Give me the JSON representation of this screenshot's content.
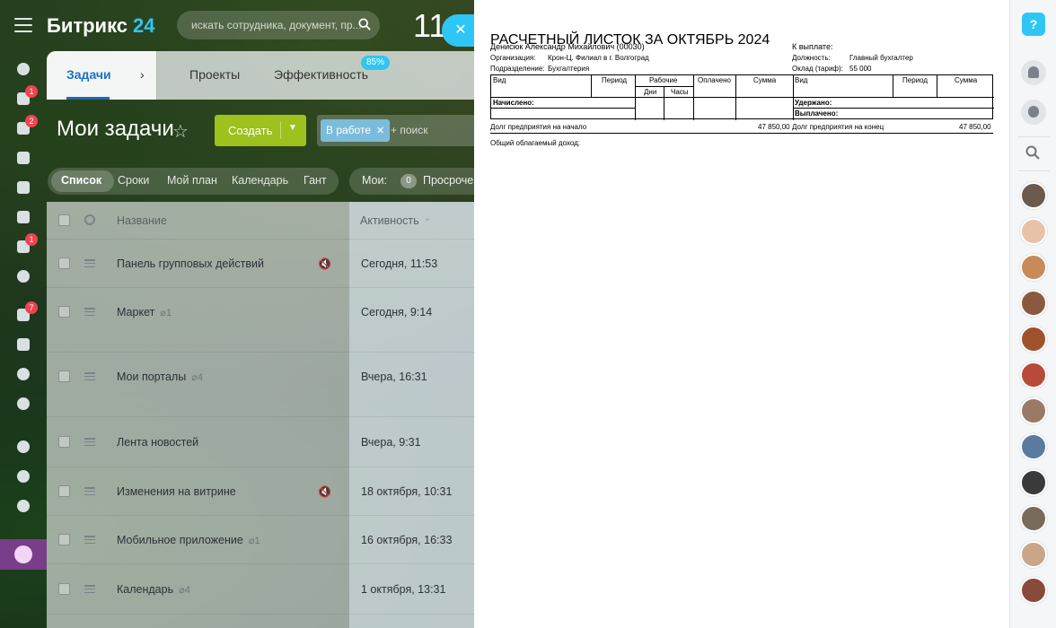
{
  "header": {
    "logo_text": "Битрикс",
    "logo_number": "24",
    "search_placeholder": "искать сотрудника, документ, пр...",
    "clock": "11"
  },
  "left_bar": {
    "badges": [
      "1",
      "2",
      "1",
      "7"
    ]
  },
  "tabs": {
    "tasks": "Задачи",
    "projects": "Проекты",
    "efficiency": "Эффективность",
    "efficiency_badge": "85%"
  },
  "title_row": {
    "title": "Мои задачи",
    "create": "Создать",
    "filter_chip": "В работе",
    "filter_placeholder": "+ поиск"
  },
  "views": {
    "items": [
      "Список",
      "Сроки",
      "Мой план",
      "Календарь",
      "Гант"
    ],
    "my_label": "Мои:",
    "my_count": "0",
    "overdue": "Просрочен"
  },
  "grid": {
    "columns": {
      "name": "Название",
      "activity": "Активность"
    },
    "rows": [
      {
        "name": "Панель групповых действий",
        "clip": "",
        "time": "Сегодня, 11:53",
        "muted": true
      },
      {
        "name": "Маркет",
        "clip": "1",
        "time": "Сегодня, 9:14",
        "muted": false
      },
      {
        "name": "Мои порталы",
        "clip": "4",
        "time": "Вчера, 16:31",
        "muted": false
      },
      {
        "name": "Лента новостей",
        "clip": "",
        "time": "Вчера, 9:31",
        "muted": false
      },
      {
        "name": "Изменения на витрине",
        "clip": "",
        "time": "18 октября, 10:31",
        "muted": true
      },
      {
        "name": "Мобильное приложение",
        "clip": "1",
        "time": "16 октября, 16:33",
        "muted": false
      },
      {
        "name": "Календарь",
        "clip": "4",
        "time": "1 октября, 13:31",
        "muted": false
      }
    ]
  },
  "payslip": {
    "title": "РАСЧЕТНЫЙ ЛИСТОК ЗА ОКТЯБРЬ 2024",
    "employee": "Денисюк Александр Михайлович (00030)",
    "org_label": "Организация:",
    "org_value": "Крон-Ц. Филиал в г. Волгоград",
    "dept_label": "Подразделение:",
    "dept_value": "Бухгалтерия",
    "to_pay_label": "К выплате:",
    "position_label": "Должность:",
    "position_value": "Главный бухгалтер",
    "salary_label": "Оклад (тариф):",
    "salary_value": "55 000",
    "table_headers": {
      "kind": "Вид",
      "period": "Период",
      "working": "Рабочие",
      "days": "Дни",
      "hours": "Часы",
      "paid": "Оплачено",
      "sum": "Сумма",
      "kind2": "Вид",
      "period2": "Период",
      "sum2": "Сумма"
    },
    "accrued": "Начислено:",
    "withheld": "Удержано:",
    "paid_out": "Выплачено:",
    "debt_start_label": "Долг предприятия на начало",
    "debt_start_value": "47 850,00",
    "debt_end_label": "Долг предприятия на конец",
    "debt_end_value": "47 850,00",
    "taxable": "Общий облагаемый доход:"
  },
  "right_bar": {
    "help": "?"
  },
  "colors": {
    "accent": "#2fc6f6",
    "create": "#9dc11d",
    "badge": "#ee4452",
    "active_tab": "#1b73c6"
  }
}
